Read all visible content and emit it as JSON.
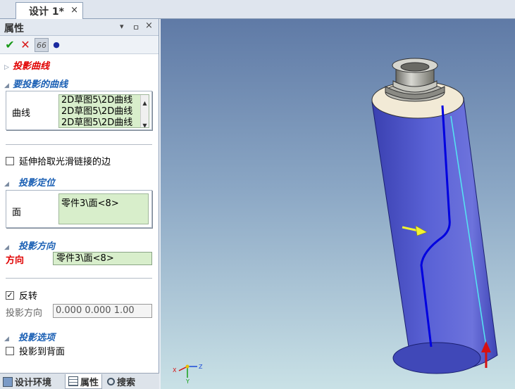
{
  "doc_tab": {
    "label": "设计 1*",
    "close": "×"
  },
  "panel": {
    "title": "属性",
    "header_buttons": {
      "dropdown": "▾",
      "pin": "ㅁ",
      "close": "×"
    },
    "toolbar": {
      "ok": "✔",
      "cancel": "✕",
      "preview": "66",
      "dot": "●"
    },
    "sections": {
      "projected_curve": "投影曲线",
      "curves_to_project": "要投影的曲线",
      "projection_placement": "投影定位",
      "projection_direction": "投影方向",
      "projection_options": "投影选项"
    },
    "curve_field": {
      "label": "曲线",
      "items": [
        "2D草图5\\2D曲线",
        "2D草图5\\2D曲线",
        "2D草图5\\2D曲线"
      ]
    },
    "extend_checkbox": {
      "label": "延伸拾取光滑链接的边",
      "checked": false
    },
    "face_field": {
      "label": "面",
      "value": "零件3\\面<8>"
    },
    "direction": {
      "label": "方向",
      "value": "零件3\\面<8>"
    },
    "reverse_checkbox": {
      "label": "反转",
      "checked": true,
      "mark": "✓"
    },
    "project_dir": {
      "label": "投影方向",
      "value": "0.000  0.000  1.00"
    },
    "back_checkbox": {
      "label": "投影到背面",
      "checked": false
    }
  },
  "bottom_tabs": [
    {
      "label": "设计环境",
      "active": false
    },
    {
      "label": "属性",
      "active": true
    },
    {
      "label": "搜索",
      "active": false
    }
  ],
  "viewport": {
    "axes": {
      "x": "X",
      "y": "Y",
      "z": "Z"
    }
  },
  "colors": {
    "accent_red": "#e00000",
    "section_blue": "#1a5fb4",
    "field_green": "#d8eecb",
    "cylinder_blue": "#4b52c8",
    "curve_blue": "#0000e0"
  }
}
